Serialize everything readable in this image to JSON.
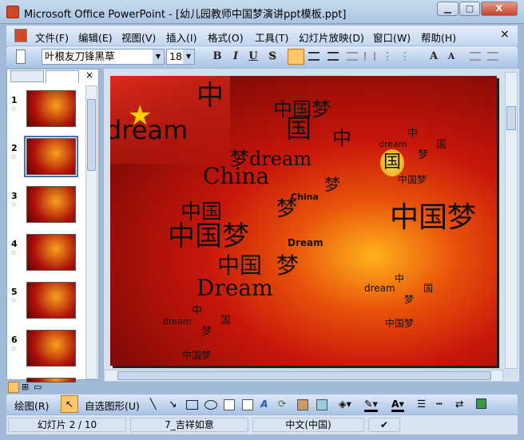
{
  "window": {
    "title": "Microsoft Office PowerPoint - [幼儿园教师中国梦演讲ppt模板.ppt]",
    "minimize": "▁",
    "maximize": "□",
    "close": "X"
  },
  "menu": [
    "文件(F)",
    "编辑(E)",
    "视图(V)",
    "插入(I)",
    "格式(O)",
    "工具(T)",
    "幻灯片放映(D)",
    "窗口(W)",
    "帮助(H)"
  ],
  "menu_close": "×",
  "toolbar": {
    "font": "叶根友刀锋黑草",
    "size": "18",
    "bold": "B",
    "italic": "I",
    "underline": "U",
    "shadow": "S",
    "grow": "A",
    "shrink": "A"
  },
  "thumbnails": [
    {
      "n": "1"
    },
    {
      "n": "2"
    },
    {
      "n": "3"
    },
    {
      "n": "4"
    },
    {
      "n": "5"
    },
    {
      "n": "6"
    }
  ],
  "slide": {
    "words": [
      "中",
      "中国梦",
      "dream",
      "国",
      "中",
      "dream",
      "中",
      "国",
      "梦",
      "梦dream",
      "国",
      "中国梦",
      "China",
      "梦",
      "China",
      "中国",
      "梦",
      "中国梦",
      "中国梦",
      "Dream",
      "中国",
      "梦",
      "中",
      "Dream",
      "dream",
      "国",
      "梦",
      "中",
      "dream",
      "国",
      "梦",
      "中国梦",
      "中国梦"
    ]
  },
  "drawbar": {
    "draw": "绘图(R)",
    "autoshapes": "自选图形(U)"
  },
  "status": {
    "slide": "幻灯片 2 / 10",
    "design": "7_吉祥如意",
    "language": "中文(中国)"
  },
  "colors": {
    "accent": "#ffc66b",
    "slide_bg": "#c8160b"
  }
}
